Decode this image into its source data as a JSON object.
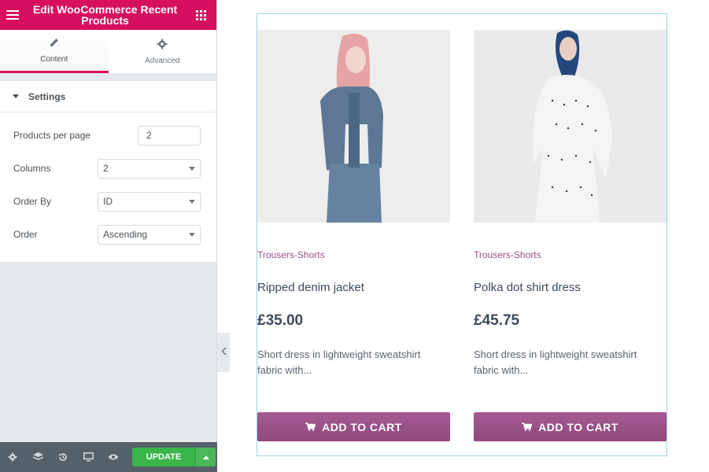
{
  "header": {
    "title": "Edit WooCommerce Recent Products"
  },
  "tabs": [
    {
      "label": "Content",
      "icon": "pencil-icon"
    },
    {
      "label": "Advanced",
      "icon": "gear-icon"
    }
  ],
  "section": {
    "title": "Settings"
  },
  "controls": {
    "products_per_page": {
      "label": "Products per page",
      "value": "2"
    },
    "columns": {
      "label": "Columns",
      "value": "2"
    },
    "order_by": {
      "label": "Order By",
      "value": "ID"
    },
    "order": {
      "label": "Order",
      "value": "Ascending"
    }
  },
  "footer": {
    "update_label": "UPDATE"
  },
  "colors": {
    "brand": "#d6105e",
    "update": "#39b54a",
    "product_button": "#9b4f8a"
  },
  "products": [
    {
      "category": "Trousers-Shorts",
      "name": "Ripped denim jacket",
      "price": "£35.00",
      "description": "Short dress in lightweight sweatshirt fabric with...",
      "button": "ADD TO CART"
    },
    {
      "category": "Trousers-Shorts",
      "name": "Polka dot shirt dress",
      "price": "£45.75",
      "description": "Short dress in lightweight sweatshirt fabric with...",
      "button": "ADD TO CART"
    }
  ]
}
